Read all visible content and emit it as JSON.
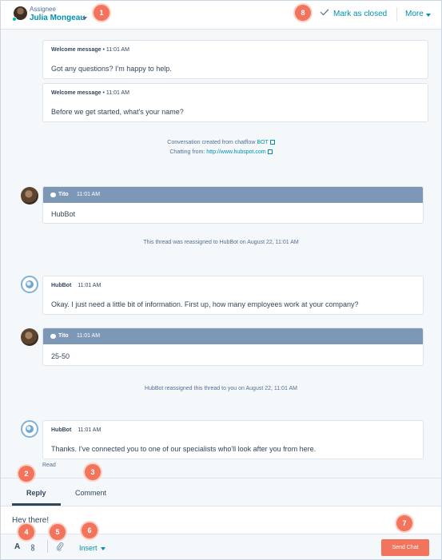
{
  "header": {
    "assignee_caption": "Assignee",
    "assignee_name": "Julia Mongeau",
    "mark_closed_label": "Mark as closed",
    "more_label": "More"
  },
  "messages": [
    {
      "kind": "welcome",
      "sender": "Welcome message",
      "separator": " • ",
      "time": "11:01 AM",
      "text": "Got any questions? I'm happy to help."
    },
    {
      "kind": "welcome",
      "sender": "Welcome message",
      "separator": " • ",
      "time": "11:01 AM",
      "text": "Before we get started, what's your name?"
    },
    {
      "kind": "visitor",
      "sender": "Tito",
      "time": "11:01 AM",
      "text": "HubBot"
    },
    {
      "kind": "bot",
      "sender": "HubBot",
      "time": "11:01 AM",
      "text": "Okay. I just need a little bit of information. First up, how many employees work at your company?"
    },
    {
      "kind": "visitor",
      "sender": "Tito",
      "time": "11:01 AM",
      "text": "25-50"
    },
    {
      "kind": "bot",
      "sender": "HubBot",
      "time": "11:01 AM",
      "text": "Thanks. I've connected you to one of our specialists who'll look after you from here."
    }
  ],
  "conversation_info": {
    "created_prefix": "Conversation created from chatflow ",
    "created_link": "BOT",
    "chatting_prefix": "Chatting from: ",
    "chatting_link": "http://www.hubspot.com"
  },
  "system_notes": [
    "This thread was reassigned to HubBot on August 22, 11:01 AM",
    "HubBot reassigned this thread to you on August 22, 11:01 AM"
  ],
  "read_label": "Read",
  "composer": {
    "tabs": [
      "Reply",
      "Comment"
    ],
    "active_tab": "Reply",
    "draft_text": "Hey there!",
    "text_format_label": "A",
    "insert_label": "Insert",
    "send_label": "Send Chat"
  },
  "callouts": [
    "1",
    "2",
    "3",
    "4",
    "5",
    "6",
    "7",
    "8"
  ],
  "colors": {
    "accent": "#0091ae",
    "callout": "#f2745c",
    "visitor_header": "#7c98b6",
    "send_button": "#f2745c",
    "background": "#f5f8fa"
  },
  "icons": [
    "assignee-avatar",
    "check-icon",
    "chevron-down-icon",
    "chat-bubble-icon",
    "external-link-icon",
    "paperclip-icon",
    "text-format-icon",
    "bot-avatar",
    "visitor-avatar"
  ]
}
